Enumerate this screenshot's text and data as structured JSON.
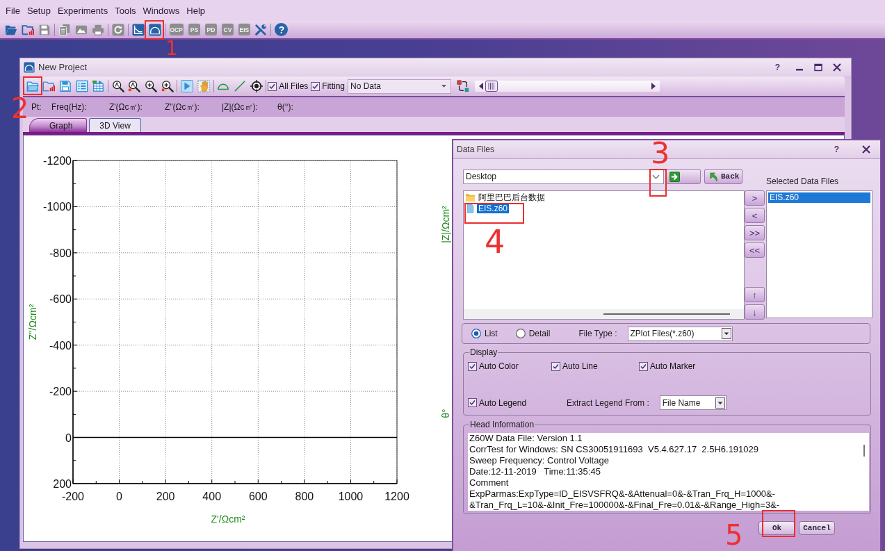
{
  "menu": [
    "File",
    "Setup",
    "Experiments",
    "Tools",
    "Windows",
    "Help"
  ],
  "toolbar": {
    "groups": [
      {
        "items": [
          {
            "kind": "open",
            "disabled": false
          },
          {
            "kind": "open-recent",
            "disabled": false
          },
          {
            "kind": "save",
            "disabled": true
          }
        ]
      },
      {
        "items": [
          {
            "kind": "copy",
            "disabled": true
          },
          {
            "kind": "image",
            "disabled": true
          },
          {
            "kind": "print",
            "disabled": true
          }
        ]
      },
      {
        "items": [
          {
            "kind": "refresh",
            "disabled": true
          }
        ]
      },
      {
        "items": [
          {
            "kind": "plot",
            "disabled": false
          },
          {
            "kind": "arc",
            "disabled": false
          }
        ]
      },
      {
        "items": [
          {
            "kind": "badge",
            "text": "OCP",
            "disabled": true
          },
          {
            "kind": "badge",
            "text": "PS",
            "disabled": true
          },
          {
            "kind": "badge",
            "text": "PD",
            "disabled": true
          },
          {
            "kind": "badge",
            "text": "CV",
            "disabled": true
          },
          {
            "kind": "badge",
            "text": "EIS",
            "disabled": true
          },
          {
            "kind": "tools",
            "disabled": false
          }
        ]
      },
      {
        "items": [
          {
            "kind": "help",
            "text": "?",
            "disabled": false
          }
        ]
      }
    ]
  },
  "project_window": {
    "title": "New Project",
    "help_label": "?",
    "toolbar": {
      "groups": [
        {
          "items": [
            {
              "kind": "open"
            },
            {
              "kind": "open-recent"
            },
            {
              "kind": "save"
            },
            {
              "kind": "list"
            },
            {
              "kind": "export"
            }
          ]
        },
        {
          "items": [
            {
              "kind": "zoom-auto"
            },
            {
              "kind": "zoom-auto-marked"
            },
            {
              "kind": "zoom-in"
            },
            {
              "kind": "zoom-in-marked"
            }
          ]
        },
        {
          "items": [
            {
              "kind": "play"
            },
            {
              "kind": "hand"
            }
          ]
        },
        {
          "items": [
            {
              "kind": "arc"
            },
            {
              "kind": "line"
            },
            {
              "kind": "target"
            }
          ]
        }
      ]
    },
    "filters": [
      {
        "label": "All Files",
        "checked": true
      },
      {
        "label": "Fitting",
        "checked": true
      }
    ],
    "dataset": {
      "value": "No Data"
    },
    "readouts": [
      "Pt:",
      "Freq(Hz):",
      "Z'(Ωc㎡):",
      "Z\"(Ωc㎡):",
      "|Z|(Ωc㎡):",
      "θ(°):"
    ],
    "tabs": [
      {
        "label": "Graph",
        "selected": true
      },
      {
        "label": "3D View",
        "selected": false
      }
    ],
    "graph": {
      "chart_data": {
        "type": "scatter",
        "xlabel": "Z'/Ωcm²",
        "ylabel": "Z''/Ωcm²",
        "xlim": [
          -200,
          1200
        ],
        "ylim": [
          200,
          -1200
        ],
        "xticks": [
          -200,
          0,
          200,
          400,
          600,
          800,
          1000,
          1200
        ],
        "yticks": [
          -1200,
          -1000,
          -800,
          -600,
          -400,
          -200,
          0,
          200
        ],
        "grid": true
      },
      "right_axis_titles": [
        "|Z|/Ωcm²",
        "θ°"
      ]
    }
  },
  "dialog": {
    "title": "Data Files",
    "help_label": "?",
    "location": "Desktop",
    "back_label": "Back",
    "selected_heading": "Selected Data Files",
    "files": [
      {
        "kind": "folder",
        "name": "阿里巴巴后台数据",
        "selected": false
      },
      {
        "kind": "file",
        "name": "EIS.z60",
        "selected": true
      }
    ],
    "transfer_buttons": [
      ">",
      "<",
      ">>",
      "<<"
    ],
    "order_buttons": [
      "↑",
      "↓"
    ],
    "selected_files": [
      {
        "name": "EIS.z60",
        "selected": true
      }
    ],
    "view_modes": [
      {
        "label": "List",
        "selected": true
      },
      {
        "label": "Detail",
        "selected": false
      }
    ],
    "file_type_label": "File Type :",
    "file_type": "ZPlot Files(*.z60)",
    "display": {
      "title": "Display",
      "options": [
        {
          "label": "Auto Color",
          "checked": true
        },
        {
          "label": "Auto Line",
          "checked": true
        },
        {
          "label": "Auto Marker",
          "checked": true
        },
        {
          "label": "Auto Legend",
          "checked": true
        }
      ],
      "extract_label": "Extract Legend From :",
      "extract_value": "File Name"
    },
    "head_info": {
      "title": "Head Information",
      "lines": [
        "Z60W Data File: Version 1.1",
        "CorrTest for Windows: SN CS30051911693  V5.4.627.17  2.5H6.191029",
        "Sweep Frequency: Control Voltage",
        "Date:12-11-2019   Time:11:35:45",
        "Comment",
        "ExpParmas:ExpType=ID_EISVSFRQ&-&Attenual=0&-&Tran_Frq_H=1000&-",
        "&Tran_Frq_L=10&-&Init_Fre=100000&-&Final_Fre=0.01&-&Range_High=3&-"
      ]
    },
    "buttons": [
      "Ok",
      "Cancel"
    ]
  },
  "annotations": [
    {
      "number": "1"
    },
    {
      "number": "2"
    },
    {
      "number": "3"
    },
    {
      "number": "4"
    },
    {
      "number": "5"
    }
  ]
}
